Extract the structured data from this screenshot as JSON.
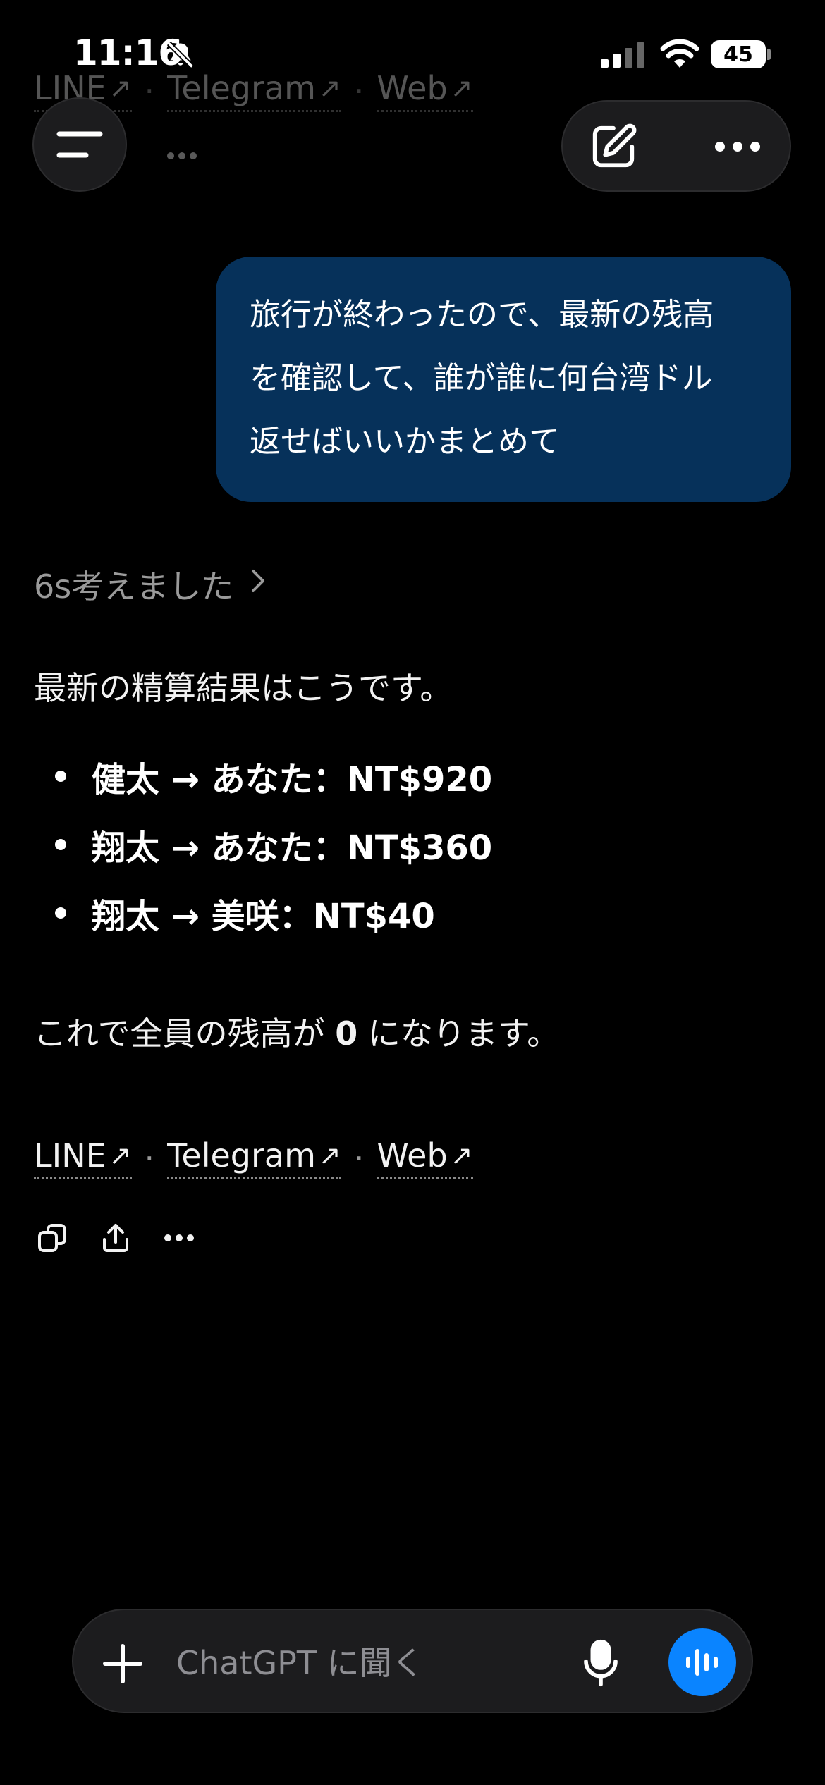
{
  "status": {
    "time": "11:16",
    "battery": "45"
  },
  "user_message": {
    "lines": [
      "旅行が終わったので、最新の残高",
      "を確認して、誰が誰に何台湾ドル",
      "返せばいいかまとめて"
    ]
  },
  "assistant": {
    "thinking_label": "6s考えました",
    "intro": "最新の精算結果はこうです。",
    "settlements": [
      "健太 → あなた：NT$920",
      "翔太 → あなた：NT$360",
      "翔太 → 美咲：NT$40"
    ],
    "summary_pre": "これで全員の残高が ",
    "summary_bold": "0",
    "summary_post": " になります。",
    "links": [
      "LINE",
      "Telegram",
      "Web"
    ],
    "link_arrow": "↗",
    "link_separator": "·"
  },
  "composer": {
    "placeholder": "ChatGPT に聞く"
  },
  "colors": {
    "background": "#000000",
    "user_bubble": "#06315a",
    "voice_button": "#0a84ff"
  }
}
